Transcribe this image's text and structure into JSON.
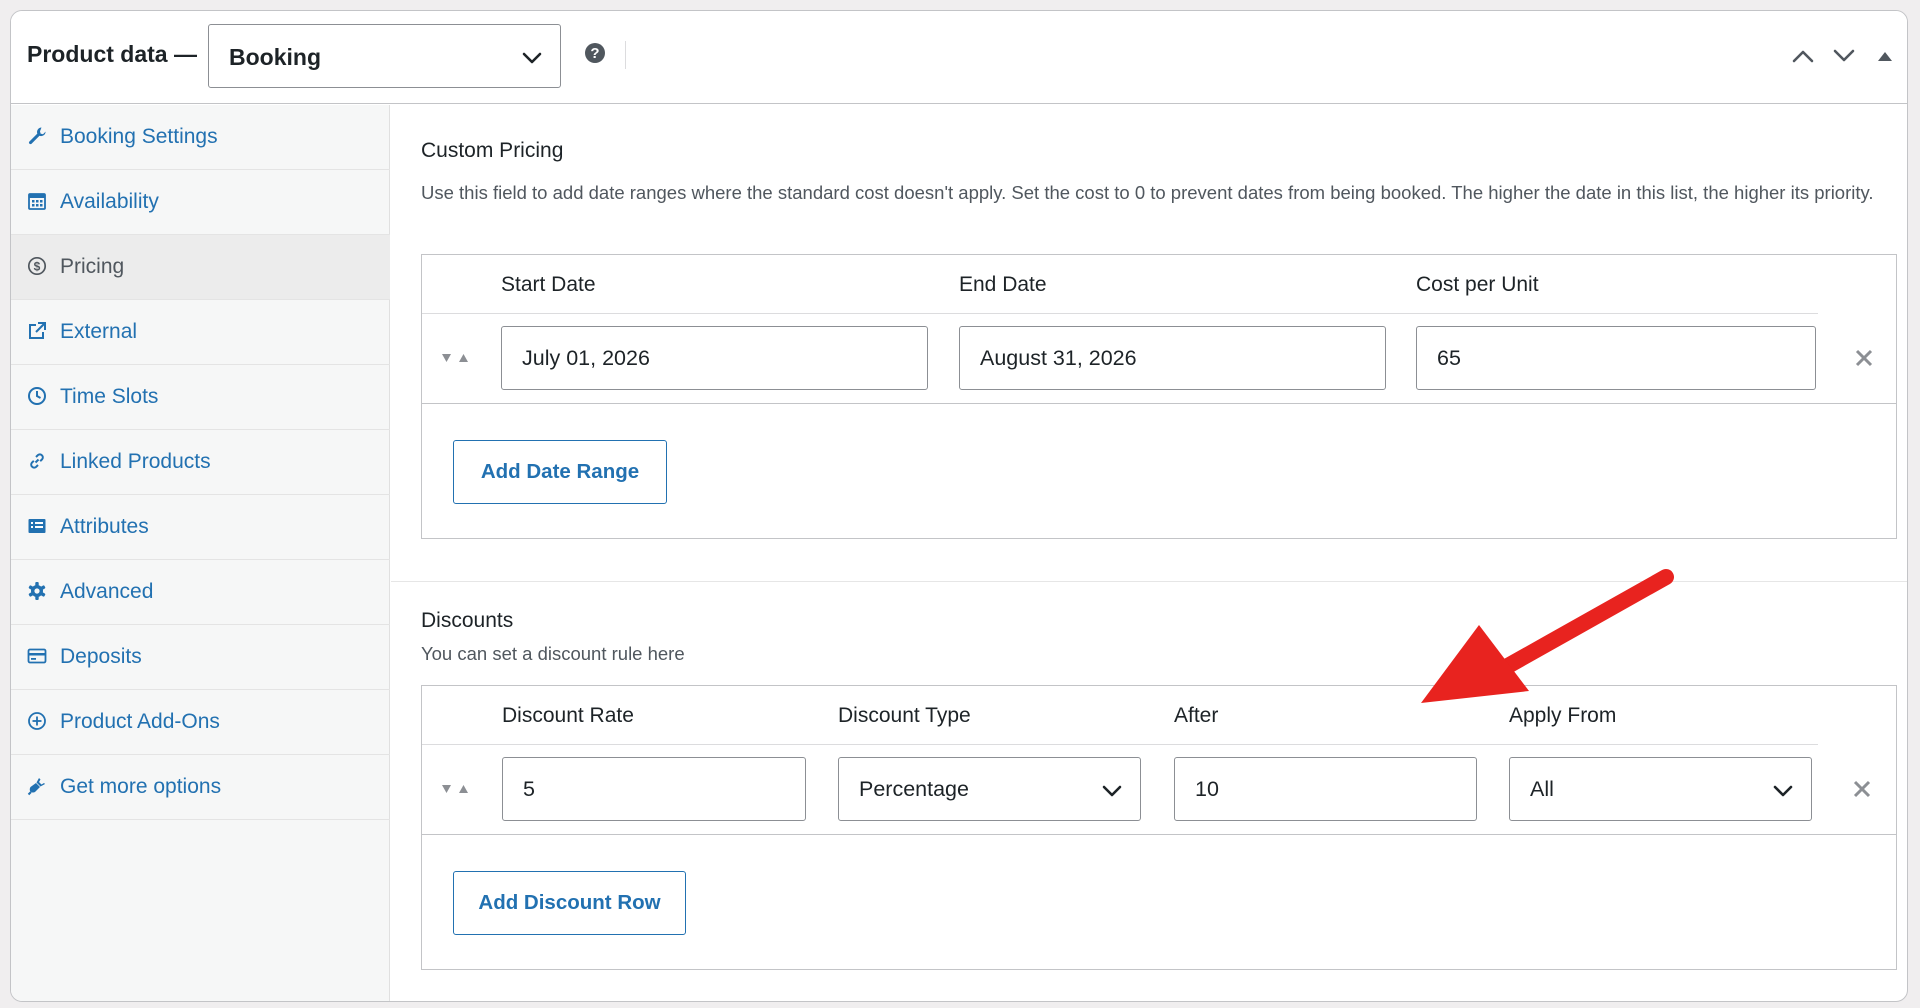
{
  "header": {
    "title": "Product data —",
    "product_type": "Booking",
    "help_icon": "question-circle-icon",
    "controls": [
      "chevron-up-icon",
      "chevron-down-icon",
      "triangle-up-icon"
    ]
  },
  "sidebar": {
    "items": [
      {
        "label": "Booking Settings",
        "icon": "wrench-icon",
        "active": false
      },
      {
        "label": "Availability",
        "icon": "calendar-icon",
        "active": false
      },
      {
        "label": "Pricing",
        "icon": "dollar-circle-icon",
        "active": true
      },
      {
        "label": "External",
        "icon": "external-link-icon",
        "active": false
      },
      {
        "label": "Time Slots",
        "icon": "clock-icon",
        "active": false
      },
      {
        "label": "Linked Products",
        "icon": "link-icon",
        "active": false
      },
      {
        "label": "Attributes",
        "icon": "list-table-icon",
        "active": false
      },
      {
        "label": "Advanced",
        "icon": "gear-icon",
        "active": false
      },
      {
        "label": "Deposits",
        "icon": "card-icon",
        "active": false
      },
      {
        "label": "Product Add-Ons",
        "icon": "plus-circle-icon",
        "active": false
      },
      {
        "label": "Get more options",
        "icon": "plugin-icon",
        "active": false
      }
    ]
  },
  "custom_pricing": {
    "title": "Custom Pricing",
    "description": "Use this field to add date ranges where the standard cost doesn't apply. Set the cost to 0 to prevent dates from being booked. The higher the date in this list, the higher its priority.",
    "columns": [
      "Start Date",
      "End Date",
      "Cost per Unit"
    ],
    "rows": [
      {
        "start_date": "July 01, 2026",
        "end_date": "August 31, 2026",
        "cost": "65"
      }
    ],
    "add_button": "Add Date Range"
  },
  "discounts": {
    "title": "Discounts",
    "description": "You can set a discount rule here",
    "columns": [
      "Discount Rate",
      "Discount Type",
      "After",
      "Apply From"
    ],
    "rows": [
      {
        "rate": "5",
        "type": "Percentage",
        "after": "10",
        "apply_from": "All"
      }
    ],
    "add_button": "Add Discount Row"
  },
  "colors": {
    "link": "#2271b1",
    "annotation_arrow": "#e8231f",
    "border": "#c3c4c7",
    "sidebar_bg": "#f6f7f7"
  }
}
